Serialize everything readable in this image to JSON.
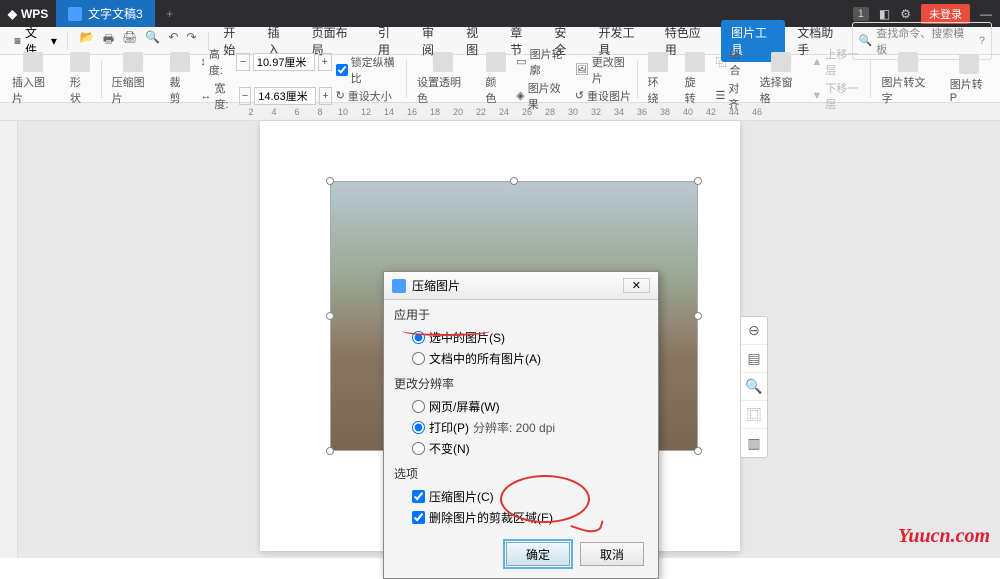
{
  "titlebar": {
    "app": "WPS",
    "doc": "文字文稿3",
    "newtab": "+",
    "badge": "1",
    "login": "未登录"
  },
  "menu": {
    "file": "文件",
    "hamburger": "≡",
    "tabs": [
      "开始",
      "插入",
      "页面布局",
      "引用",
      "审阅",
      "视图",
      "章节",
      "安全",
      "开发工具",
      "特色应用",
      "图片工具",
      "文档助手"
    ],
    "active_index": 10,
    "search_placeholder": "查找命令、搜索模板"
  },
  "ribbon": {
    "insert_pic": "插入图片",
    "shape": "形状",
    "compress": "压缩图片",
    "crop": "裁剪",
    "height_label": "高度:",
    "height_val": "10.97厘米",
    "width_label": "宽度:",
    "width_val": "14.63厘米",
    "lock_ratio": "锁定纵横比",
    "reset_size": "重设大小",
    "set_transparent": "设置透明色",
    "color": "颜色",
    "outline": "图片轮廓",
    "effects": "图片效果",
    "change_pic": "更改图片",
    "reset_pic": "重设图片",
    "wrap": "环绕",
    "rotate": "旋转",
    "combine": "组合",
    "align": "对齐",
    "sel_pane": "选择窗格",
    "up_layer": "上移一层",
    "down_layer": "下移一层",
    "pic2text": "图片转文字",
    "pic2p": "图片转P"
  },
  "dialog": {
    "title": "压缩图片",
    "sec_apply": "应用于",
    "opt_selected": "选中的图片(S)",
    "opt_alldoc": "文档中的所有图片(A)",
    "sec_res": "更改分辨率",
    "opt_web": "网页/屏幕(W)",
    "opt_print": "打印(P)",
    "res_label": "分辨率: 200 dpi",
    "opt_nochange": "不变(N)",
    "sec_opt": "选项",
    "chk_compress": "压缩图片(C)",
    "chk_delcrop": "删除图片的剪裁区域(E)",
    "ok": "确定",
    "cancel": "取消"
  },
  "float_icons": [
    "⊖",
    "▤",
    "🔍",
    "⿴",
    "▥"
  ],
  "watermark": "Yuucn.com"
}
